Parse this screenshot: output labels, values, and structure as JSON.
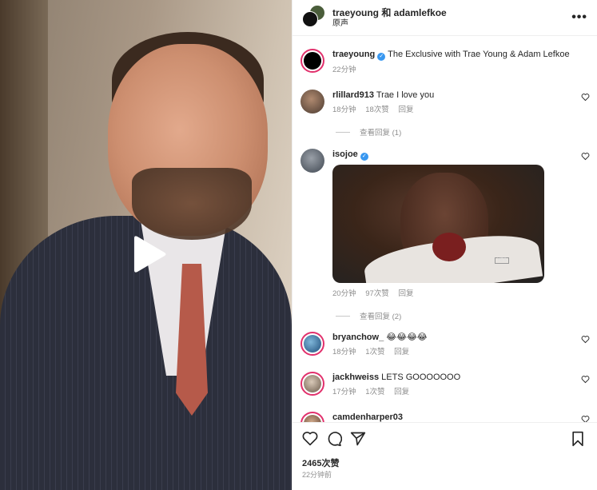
{
  "header": {
    "title": "traeyoung 和 adamlefkoe",
    "subtitle": "原声",
    "more_icon": "more-horizontal-icon"
  },
  "caption": {
    "username": "traeyoung",
    "verified": true,
    "text": "The Exclusive with Trae Young & Adam Lefkoe",
    "time": "22分钟"
  },
  "comments": [
    {
      "username": "rlillard913",
      "text": "Trae I love you",
      "time": "18分钟",
      "likes": "18次赞",
      "reply": "回复",
      "view_replies": "查看回复 (1)"
    },
    {
      "username": "isojoe",
      "verified": true,
      "text": "",
      "time": "20分钟",
      "likes": "97次赞",
      "reply": "回复",
      "view_replies": "查看回复 (2)"
    },
    {
      "username": "bryanchow_",
      "text": "😂😂😂😂",
      "time": "18分钟",
      "likes": "1次赞",
      "reply": "回复"
    },
    {
      "username": "jackhweiss",
      "text": "LETS GOOOOOOO",
      "time": "17分钟",
      "likes": "1次赞",
      "reply": "回复"
    },
    {
      "username": "camdenharper03",
      "text": ""
    }
  ],
  "footer": {
    "likes": "2465次赞",
    "time": "22分钟前",
    "icons": [
      "heart-icon",
      "comment-icon",
      "share-icon",
      "bookmark-icon"
    ]
  },
  "colors": {
    "verified": "#3897f0",
    "muted": "#8e8e8e",
    "text": "#262626"
  }
}
